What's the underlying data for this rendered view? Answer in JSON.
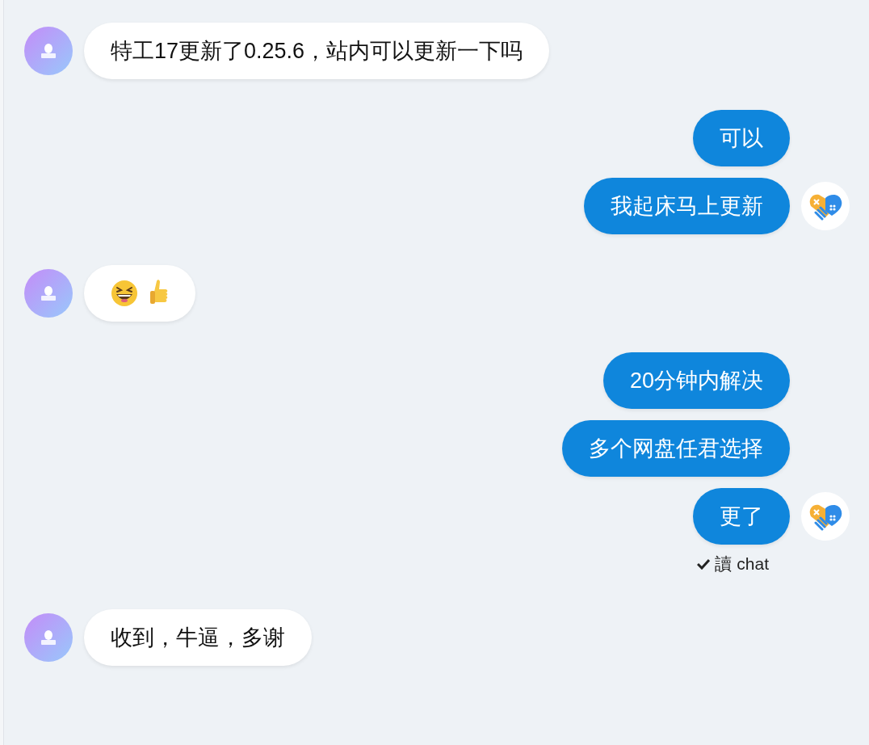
{
  "groups": [
    {
      "kind": "received",
      "messages": [
        {
          "kind": "text",
          "text": "特工17更新了0.25.6，站内可以更新一下吗"
        }
      ]
    },
    {
      "kind": "sent",
      "messages": [
        {
          "kind": "text",
          "text": "可以"
        },
        {
          "kind": "text",
          "text": "我起床马上更新"
        }
      ]
    },
    {
      "kind": "received",
      "messages": [
        {
          "kind": "reaction"
        }
      ]
    },
    {
      "kind": "sent",
      "messages": [
        {
          "kind": "text",
          "text": "20分钟内解决"
        },
        {
          "kind": "text",
          "text": "多个网盘任君选择"
        },
        {
          "kind": "text",
          "text": "更了"
        }
      ],
      "receipt": {
        "read": true,
        "text": "讀 chat"
      }
    },
    {
      "kind": "received",
      "messages": [
        {
          "kind": "text",
          "text": "收到，牛逼，多谢"
        }
      ]
    }
  ]
}
